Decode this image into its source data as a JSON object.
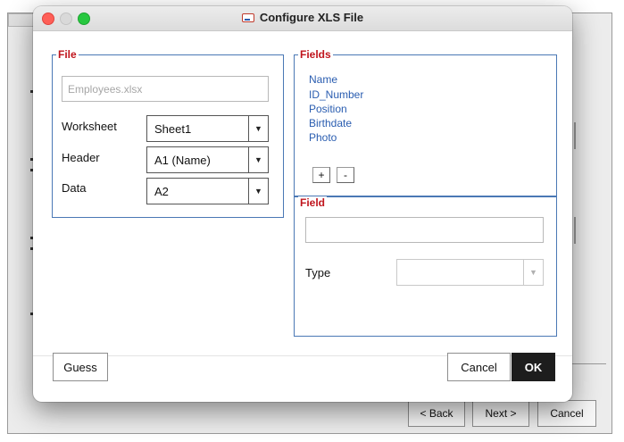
{
  "dialog": {
    "title": "Configure XLS File",
    "icon": "window-icon"
  },
  "file_group": {
    "legend": "File",
    "filename_placeholder": "Employees.xlsx",
    "worksheet": {
      "label": "Worksheet",
      "value": "Sheet1"
    },
    "header": {
      "label": "Header",
      "value": "A1 (Name)"
    },
    "data": {
      "label": "Data",
      "value": "A2"
    }
  },
  "fields_group": {
    "legend": "Fields",
    "items": [
      "Name",
      "ID_Number",
      "Position",
      "Birthdate",
      "Photo"
    ],
    "add_label": "+",
    "remove_label": "-"
  },
  "field_group": {
    "legend": "Field",
    "name_value": "",
    "type_label": "Type",
    "type_value": ""
  },
  "buttons": {
    "guess": "Guess",
    "cancel": "Cancel",
    "ok": "OK"
  },
  "wizard": {
    "back": "< Back",
    "next": "Next >",
    "cancel": "Cancel"
  },
  "colors": {
    "legend": "#c0141c",
    "group_border": "#4a78b5",
    "field_item": "#2a5db0",
    "ok_bg": "#1d1d1d",
    "close": "#fe5f57",
    "minimize": "#d9d9d9",
    "zoom": "#28c840"
  }
}
